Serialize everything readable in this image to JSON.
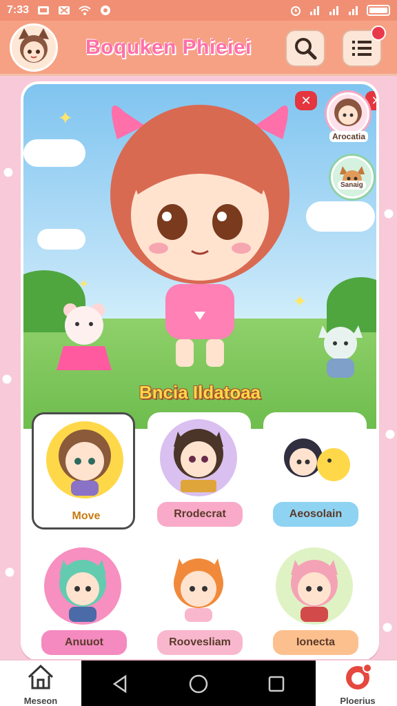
{
  "status": {
    "time": "7:33",
    "icons": [
      "message-icon",
      "missed-call-icon",
      "wifi-icon",
      "settings-icon",
      "alarm-icon",
      "signal-icon",
      "signal-icon",
      "signal-icon",
      "battery-icon"
    ]
  },
  "header": {
    "title": "Boquken Phieiei",
    "search_icon": "search-icon",
    "menu_icon": "menu-list-icon"
  },
  "scene": {
    "title": "Bncia Ildatoaa"
  },
  "side_avatars": [
    {
      "label": "Arocatia"
    },
    {
      "label": "Sanaig"
    }
  ],
  "grid": [
    {
      "label": "Move",
      "color": "#ffd84a",
      "label_bg": "#ffffff"
    },
    {
      "label": "Rrodecrat",
      "color": "#d9c0f0",
      "label_bg": "#f8aac8"
    },
    {
      "label": "Aeosolain",
      "color": "#ffffff",
      "label_bg": "#8fd3f2"
    },
    {
      "label": "Anuuot",
      "color": "#f78fc0",
      "label_bg": "#f48ac0"
    },
    {
      "label": "Roovesliam",
      "color": "#ffffff",
      "label_bg": "#f9b7ce"
    },
    {
      "label": "Ionecta",
      "color": "#dff2c4",
      "label_bg": "#fcc08e"
    }
  ],
  "nav": {
    "home_label": "Meseon",
    "profile_label": "Ploerius"
  },
  "colors": {
    "status_bar": "#f08f74",
    "header": "#f6a184",
    "title": "#ff6fa9",
    "accent_red": "#e5353f"
  }
}
